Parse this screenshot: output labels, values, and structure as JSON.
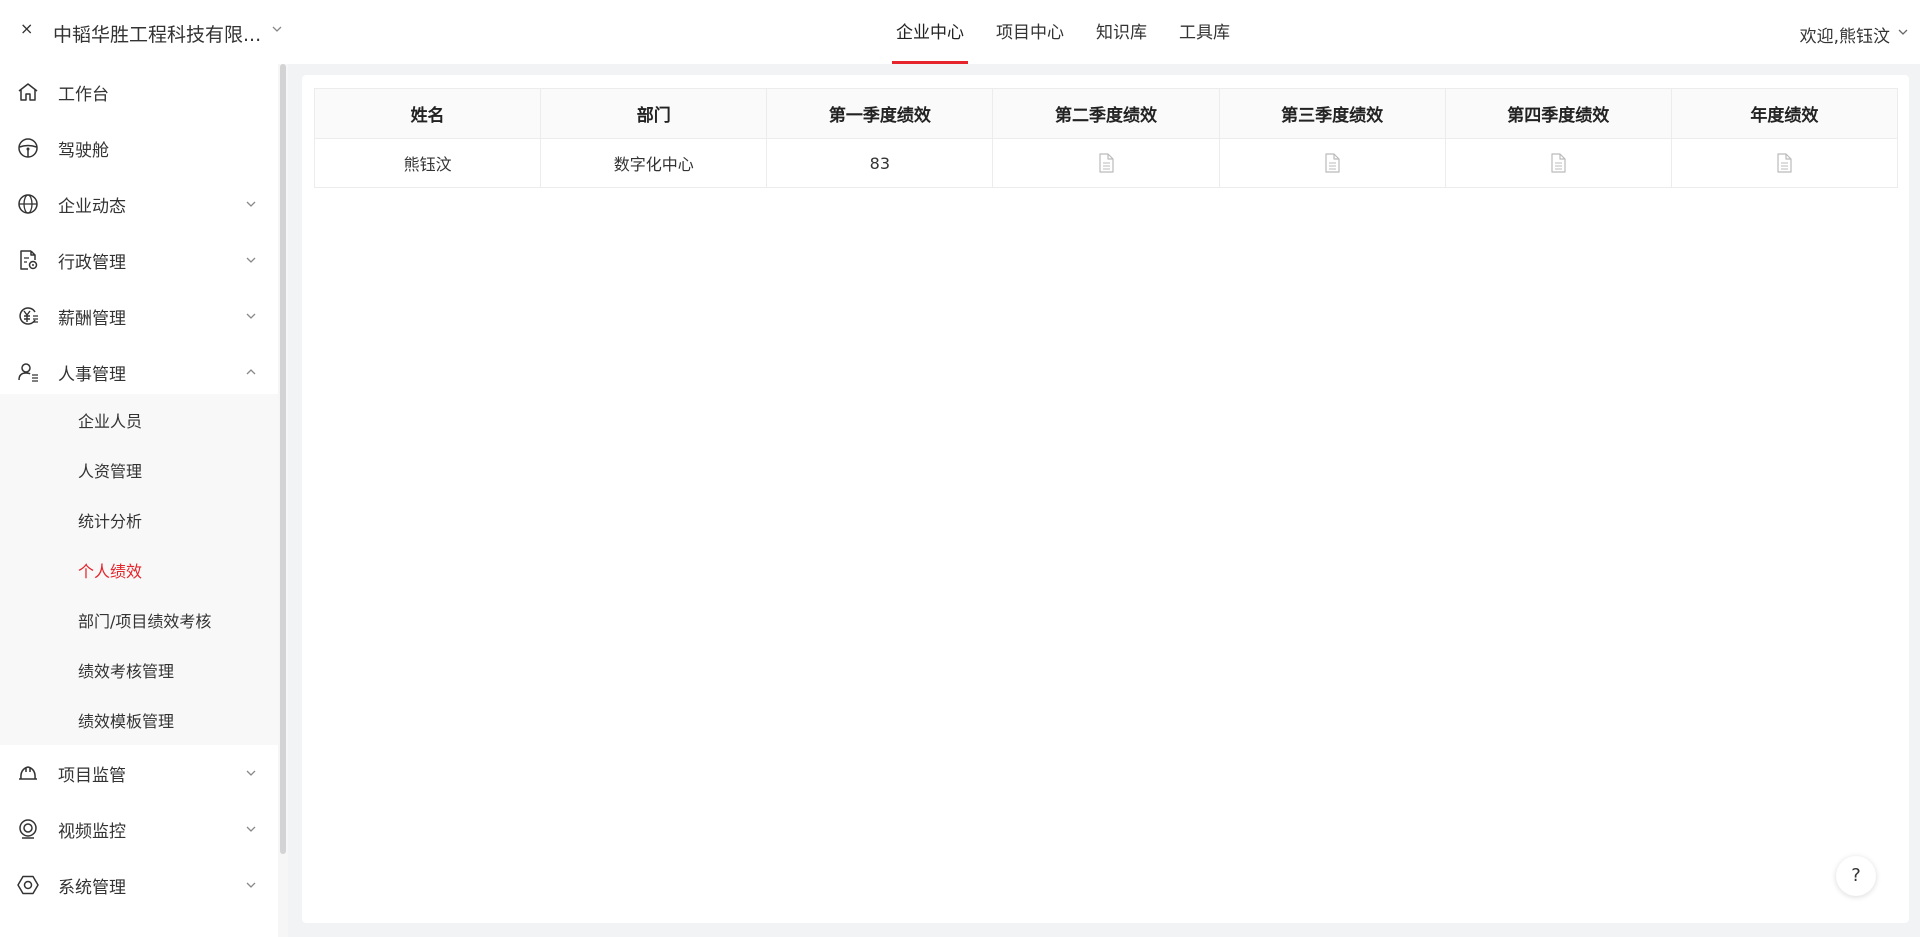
{
  "header": {
    "close_glyph": "×",
    "company_name": "中韬华胜工程科技有限...",
    "tabs": [
      {
        "label": "企业中心",
        "active": true
      },
      {
        "label": "项目中心",
        "active": false
      },
      {
        "label": "知识库",
        "active": false
      },
      {
        "label": "工具库",
        "active": false
      }
    ],
    "welcome": "欢迎,熊钰汶"
  },
  "sidebar": {
    "items": [
      {
        "label": "工作台",
        "icon": "home-icon"
      },
      {
        "label": "驾驶舱",
        "icon": "steering-wheel-icon"
      },
      {
        "label": "企业动态",
        "icon": "globe-icon"
      },
      {
        "label": "行政管理",
        "icon": "document-gear-icon"
      },
      {
        "label": "薪酬管理",
        "icon": "yen-refresh-icon"
      },
      {
        "label": "人事管理",
        "icon": "user-list-icon"
      },
      {
        "label": "项目监管",
        "icon": "helmet-icon"
      },
      {
        "label": "视频监控",
        "icon": "camera-icon"
      },
      {
        "label": "系统管理",
        "icon": "hexagon-gear-icon"
      }
    ],
    "sub_items": [
      {
        "label": "企业人员",
        "active": false
      },
      {
        "label": "人资管理",
        "active": false
      },
      {
        "label": "统计分析",
        "active": false
      },
      {
        "label": "个人绩效",
        "active": true
      },
      {
        "label": "部门/项目绩效考核",
        "active": false
      },
      {
        "label": "绩效考核管理",
        "active": false
      },
      {
        "label": "绩效模板管理",
        "active": false
      }
    ]
  },
  "table": {
    "headers": [
      "姓名",
      "部门",
      "第一季度绩效",
      "第二季度绩效",
      "第三季度绩效",
      "第四季度绩效",
      "年度绩效"
    ],
    "rows": [
      {
        "name": "熊钰汶",
        "department": "数字化中心",
        "q1": "83"
      }
    ]
  },
  "help": {
    "label": "?"
  },
  "colors": {
    "accent": "#e5242b",
    "sidebar_sub_bg": "#f8f8f8",
    "page_bg": "#f2f3f5"
  }
}
